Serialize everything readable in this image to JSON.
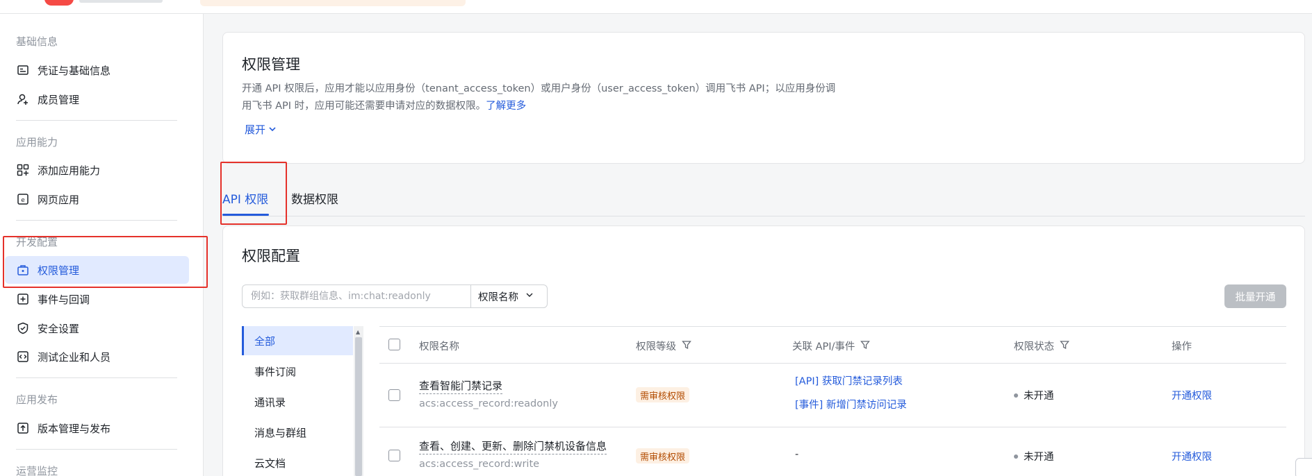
{
  "sidebar": {
    "groups": [
      {
        "title": "基础信息",
        "items": [
          {
            "label": "凭证与基础信息",
            "icon": "id-card-icon"
          },
          {
            "label": "成员管理",
            "icon": "add-user-icon"
          }
        ]
      },
      {
        "title": "应用能力",
        "items": [
          {
            "label": "添加应用能力",
            "icon": "grid-plus-icon"
          },
          {
            "label": "网页应用",
            "icon": "web-app-icon"
          }
        ]
      },
      {
        "title": "开发配置",
        "items": [
          {
            "label": "权限管理",
            "icon": "briefcase-lock-icon",
            "active": true
          },
          {
            "label": "事件与回调",
            "icon": "event-plus-icon"
          },
          {
            "label": "安全设置",
            "icon": "shield-check-icon"
          },
          {
            "label": "测试企业和人员",
            "icon": "code-box-icon"
          }
        ]
      },
      {
        "title": "应用发布",
        "items": [
          {
            "label": "版本管理与发布",
            "icon": "upload-box-icon"
          }
        ]
      },
      {
        "title": "运营监控",
        "items": []
      }
    ]
  },
  "header": {
    "title": "权限管理",
    "desc_line1": "开通 API 权限后，应用才能以应用身份（tenant_access_token）或用户身份（user_access_token）调用飞书 API；以应用身份调",
    "desc_line2": "用飞书 API 时，应用可能还需要申请对应的数据权限。",
    "learn_more": "了解更多",
    "expand": "展开"
  },
  "tabs": [
    {
      "label": "API 权限",
      "active": true
    },
    {
      "label": "数据权限",
      "active": false
    }
  ],
  "config": {
    "title": "权限配置",
    "search_placeholder": "例如：获取群组信息、im:chat:readonly",
    "search_field": "权限名称",
    "batch_button": "批量开通"
  },
  "categories": [
    "全部",
    "事件订阅",
    "通讯录",
    "消息与群组",
    "云文档"
  ],
  "table": {
    "columns": [
      "权限名称",
      "权限等级",
      "关联 API/事件",
      "权限状态",
      "操作"
    ],
    "rows": [
      {
        "name": "查看智能门禁记录",
        "code": "acs:access_record:readonly",
        "level": "需审核权限",
        "apis": [
          "[API] 获取门禁记录列表",
          "[事件] 新增门禁访问记录"
        ],
        "status": "未开通",
        "action": "开通权限"
      },
      {
        "name": "查看、创建、更新、删除门禁机设备信息",
        "code": "acs:access_record:write",
        "level": "需审核权限",
        "apis": [
          "-"
        ],
        "status": "未开通",
        "action": "开通权限"
      }
    ]
  },
  "colors": {
    "accent": "#245bdb",
    "active_bg": "#e1eaff",
    "highlight_box": "#e5312a",
    "tag_bg": "#fdf0e3",
    "tag_text": "#b24b00"
  }
}
